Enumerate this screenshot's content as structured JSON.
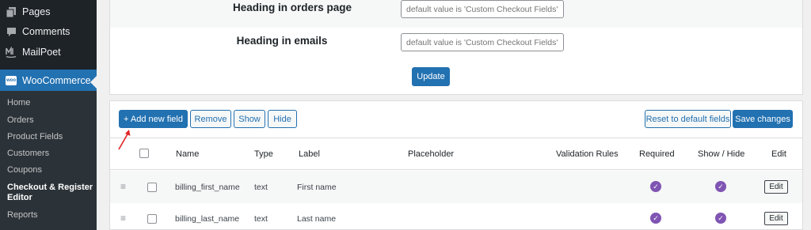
{
  "sidebar": {
    "items": [
      {
        "label": "Pages",
        "icon": "pages-icon"
      },
      {
        "label": "Comments",
        "icon": "comments-icon"
      },
      {
        "label": "MailPoet",
        "icon": "mailpoet-icon"
      },
      {
        "label": "WooCommerce",
        "icon": "woocommerce-icon"
      }
    ],
    "submenu": [
      "Home",
      "Orders",
      "Product Fields",
      "Customers",
      "Coupons",
      "Checkout & Register",
      "Editor",
      "Reports"
    ],
    "woo_badge": "woo"
  },
  "settings": {
    "rows": [
      {
        "label": "Heading in orders page",
        "placeholder": "default value is 'Custom Checkout Fields'"
      },
      {
        "label": "Heading in emails",
        "placeholder": "default value is 'Custom Checkout Fields'"
      }
    ],
    "update_label": "Update"
  },
  "toolbar": {
    "add_label": "+ Add new field",
    "remove_label": "Remove",
    "show_label": "Show",
    "hide_label": "Hide",
    "reset_label": "Reset to default fields",
    "save_label": "Save changes"
  },
  "table": {
    "headers": {
      "name": "Name",
      "type": "Type",
      "label": "Label",
      "placeholder": "Placeholder",
      "validation": "Validation Rules",
      "required": "Required",
      "show_hide": "Show / Hide",
      "edit": "Edit"
    },
    "rows": [
      {
        "name": "billing_first_name",
        "type": "text",
        "label": "First name",
        "placeholder": "",
        "required": true,
        "shown": true,
        "edit": "Edit"
      },
      {
        "name": "billing_last_name",
        "type": "text",
        "label": "Last name",
        "placeholder": "",
        "required": true,
        "shown": true,
        "edit": "Edit"
      }
    ]
  },
  "colors": {
    "accent": "#2271b1",
    "sidebar": "#1d2327",
    "check": "#7f54b3",
    "annotation": "#e02424"
  }
}
